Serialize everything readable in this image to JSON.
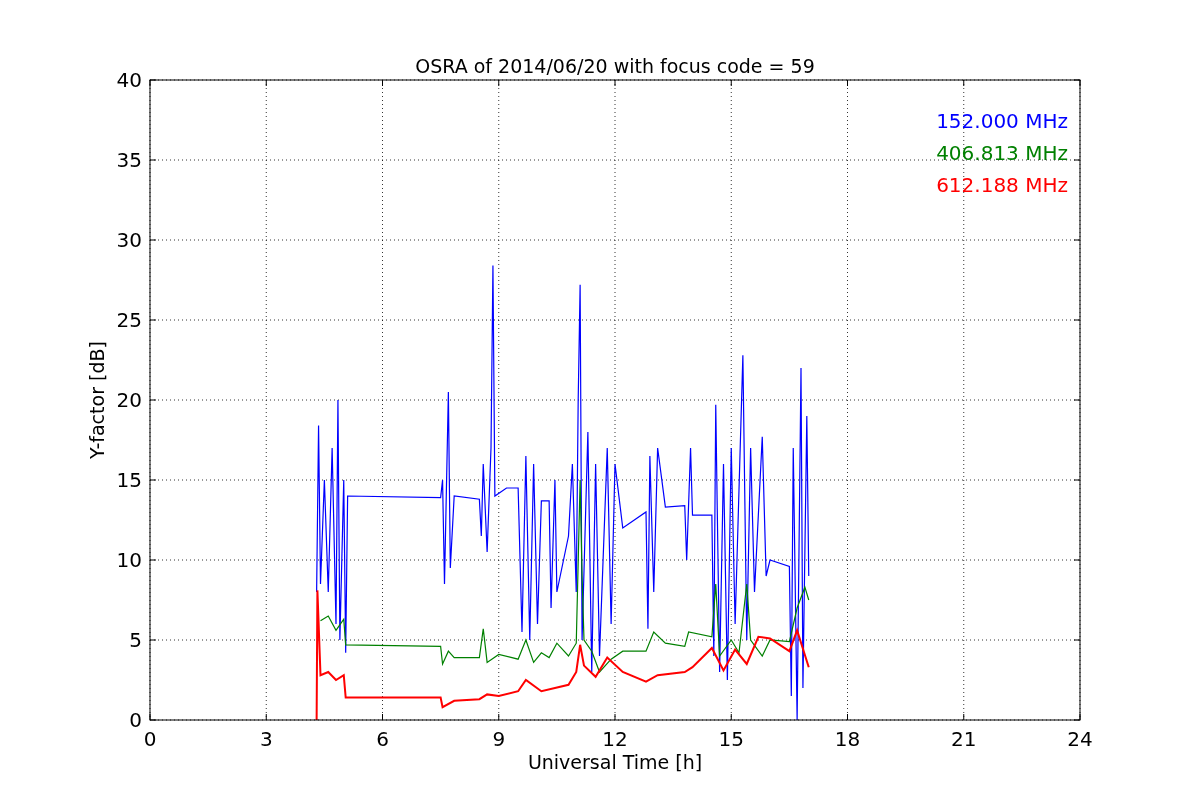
{
  "figure": {
    "chart_data": {
      "type": "line",
      "title": "OSRA of 2014/06/20 with focus code = 59",
      "xlabel": "Universal Time [h]",
      "ylabel": "Y-factor [dB]",
      "grid": true,
      "xlim": [
        0,
        24
      ],
      "ylim": [
        0,
        40
      ],
      "xticks": [
        0,
        3,
        6,
        9,
        12,
        15,
        18,
        21,
        24
      ],
      "yticks": [
        0,
        5,
        10,
        15,
        20,
        25,
        30,
        35,
        40
      ],
      "series": [
        {
          "name": "152.000 MHz",
          "color": "#0000ff",
          "x": [
            4.3,
            4.35,
            4.4,
            4.5,
            4.6,
            4.7,
            4.8,
            4.85,
            4.9,
            5.0,
            5.05,
            5.1,
            7.5,
            7.55,
            7.6,
            7.7,
            7.75,
            7.85,
            8.5,
            8.55,
            8.6,
            8.7,
            8.8,
            8.85,
            8.9,
            9.2,
            9.5,
            9.6,
            9.7,
            9.8,
            9.9,
            10.0,
            10.1,
            10.3,
            10.35,
            10.45,
            10.5,
            10.8,
            10.9,
            11.0,
            11.05,
            11.1,
            11.15,
            11.3,
            11.4,
            11.5,
            11.6,
            11.8,
            11.9,
            12.0,
            12.2,
            12.8,
            12.85,
            12.9,
            13.0,
            13.1,
            13.3,
            13.8,
            13.85,
            13.95,
            14.0,
            14.5,
            14.55,
            14.6,
            14.7,
            14.8,
            14.9,
            15.0,
            15.1,
            15.3,
            15.4,
            15.5,
            15.6,
            15.8,
            15.9,
            16.0,
            16.5,
            16.55,
            16.6,
            16.7,
            16.8,
            16.85,
            16.95,
            17.0
          ],
          "values": [
            8,
            18.4,
            8.5,
            15,
            8,
            17,
            6,
            20,
            5,
            15,
            4.2,
            14,
            13.9,
            15,
            8.5,
            20.5,
            9.5,
            14,
            13.8,
            11.5,
            16,
            10.5,
            17,
            28.4,
            14,
            14.5,
            14.5,
            5.5,
            16.5,
            5,
            16,
            6,
            13.7,
            13.7,
            7,
            15,
            8,
            11.5,
            16,
            8,
            20,
            27.2,
            5,
            18,
            3,
            16,
            4,
            17,
            6,
            16,
            12,
            13,
            5.7,
            16.5,
            8,
            17,
            13.3,
            13.4,
            10,
            17,
            12.8,
            12.8,
            4,
            19.7,
            3,
            16,
            2.5,
            17,
            6,
            22.8,
            5,
            17,
            8,
            17.7,
            9,
            10,
            9.6,
            1.5,
            17,
            0,
            22,
            2,
            19,
            9
          ]
        },
        {
          "name": "406.813 MHz",
          "color": "#008000",
          "x": [
            4.4,
            4.6,
            4.8,
            5.0,
            5.05,
            7.5,
            7.55,
            7.7,
            7.85,
            8.5,
            8.6,
            8.7,
            9.0,
            9.5,
            9.7,
            9.9,
            10.1,
            10.3,
            10.5,
            10.8,
            11.0,
            11.1,
            11.15,
            11.2,
            11.4,
            11.6,
            11.9,
            12.2,
            12.8,
            13.0,
            13.3,
            13.8,
            13.9,
            14.5,
            14.6,
            14.7,
            15.0,
            15.2,
            15.4,
            15.5,
            15.8,
            16.0,
            16.5,
            16.7,
            16.9,
            17.0
          ],
          "values": [
            6.2,
            6.5,
            5.6,
            6.3,
            4.7,
            4.6,
            3.5,
            4.3,
            3.9,
            3.9,
            5.7,
            3.6,
            4.1,
            3.8,
            5,
            3.6,
            4.2,
            3.9,
            4.8,
            4,
            4.8,
            15,
            9,
            5,
            4.3,
            3,
            3.8,
            4.3,
            4.3,
            5.5,
            4.8,
            4.6,
            5.5,
            5.2,
            8.5,
            4,
            5,
            4.2,
            8.5,
            5,
            4,
            5,
            4.9,
            7,
            8.3,
            7.5
          ]
        },
        {
          "name": "612.188 MHz",
          "color": "#ff0000",
          "x": [
            4.3,
            4.32,
            4.4,
            4.6,
            4.8,
            5.0,
            5.05,
            7.5,
            7.55,
            7.85,
            8.5,
            8.7,
            9.0,
            9.5,
            9.7,
            10.1,
            10.8,
            11.0,
            11.1,
            11.2,
            11.5,
            11.8,
            12.2,
            12.8,
            13.1,
            13.8,
            14.0,
            14.5,
            14.8,
            15.1,
            15.4,
            15.7,
            16.0,
            16.5,
            16.7,
            17.0
          ],
          "values": [
            0,
            8.1,
            2.8,
            3,
            2.5,
            2.8,
            1.4,
            1.4,
            0.8,
            1.2,
            1.3,
            1.6,
            1.5,
            1.8,
            2.5,
            1.8,
            2.2,
            3,
            4.7,
            3.4,
            2.7,
            3.9,
            3,
            2.4,
            2.8,
            3,
            3.3,
            4.5,
            3.1,
            4.4,
            3.5,
            5.2,
            5.1,
            4.3,
            5.6,
            3.3
          ]
        }
      ]
    }
  }
}
